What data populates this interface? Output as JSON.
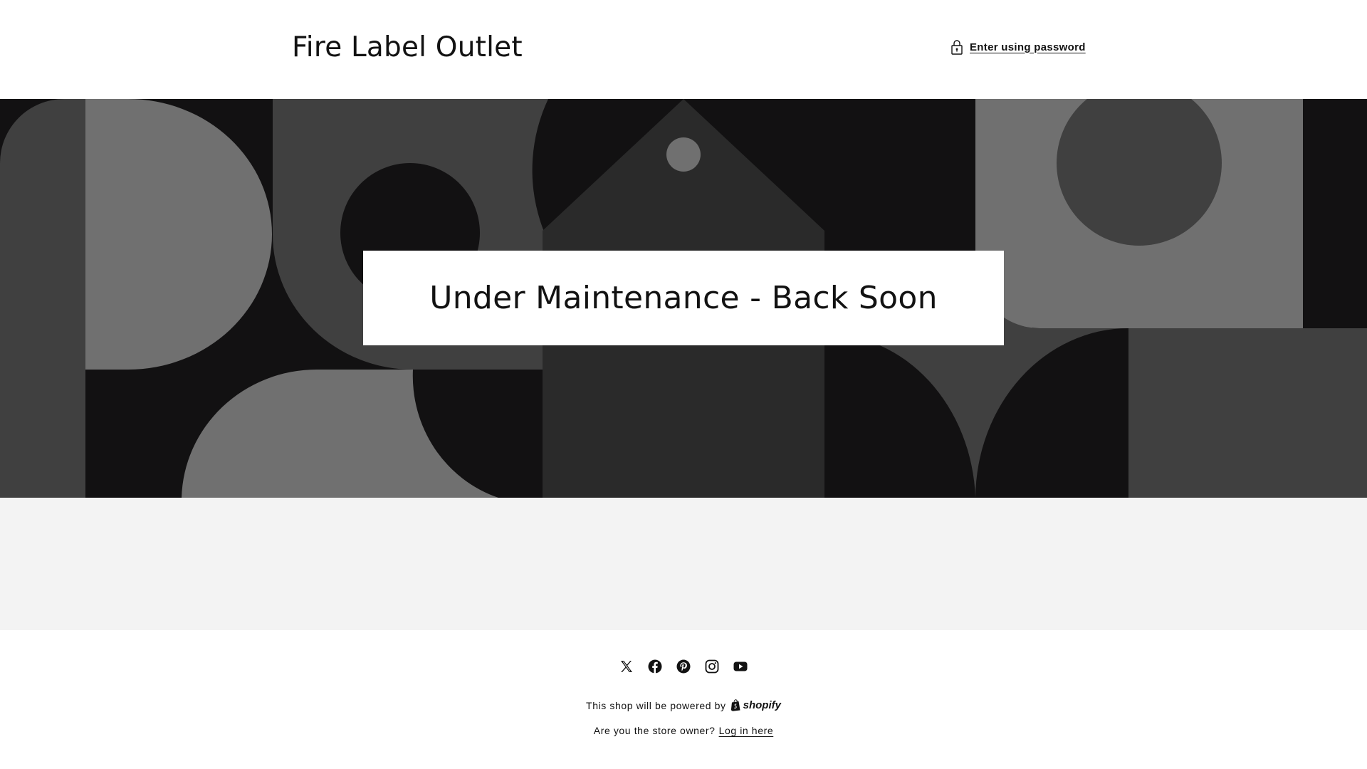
{
  "header": {
    "store_name": "Fire Label Outlet",
    "password_link_label": "Enter using password",
    "password_icon": "lock-icon"
  },
  "hero": {
    "heading": "Under Maintenance - Back Soon"
  },
  "footer": {
    "social_icons": [
      "x-twitter-icon",
      "facebook-icon",
      "pinterest-icon",
      "instagram-icon",
      "youtube-icon"
    ],
    "powered_by_text": "This shop will be powered by",
    "shopify_wordmark": "shopify",
    "owner_prompt": "Are you the store owner?",
    "login_link": "Log in here"
  },
  "colors": {
    "text": "#121212",
    "hero_dark": "#121112",
    "hero_mid": "#404040",
    "hero_light": "#707070",
    "hero_darkgrey": "#2a2a2a",
    "band": "#f3f3f3"
  }
}
